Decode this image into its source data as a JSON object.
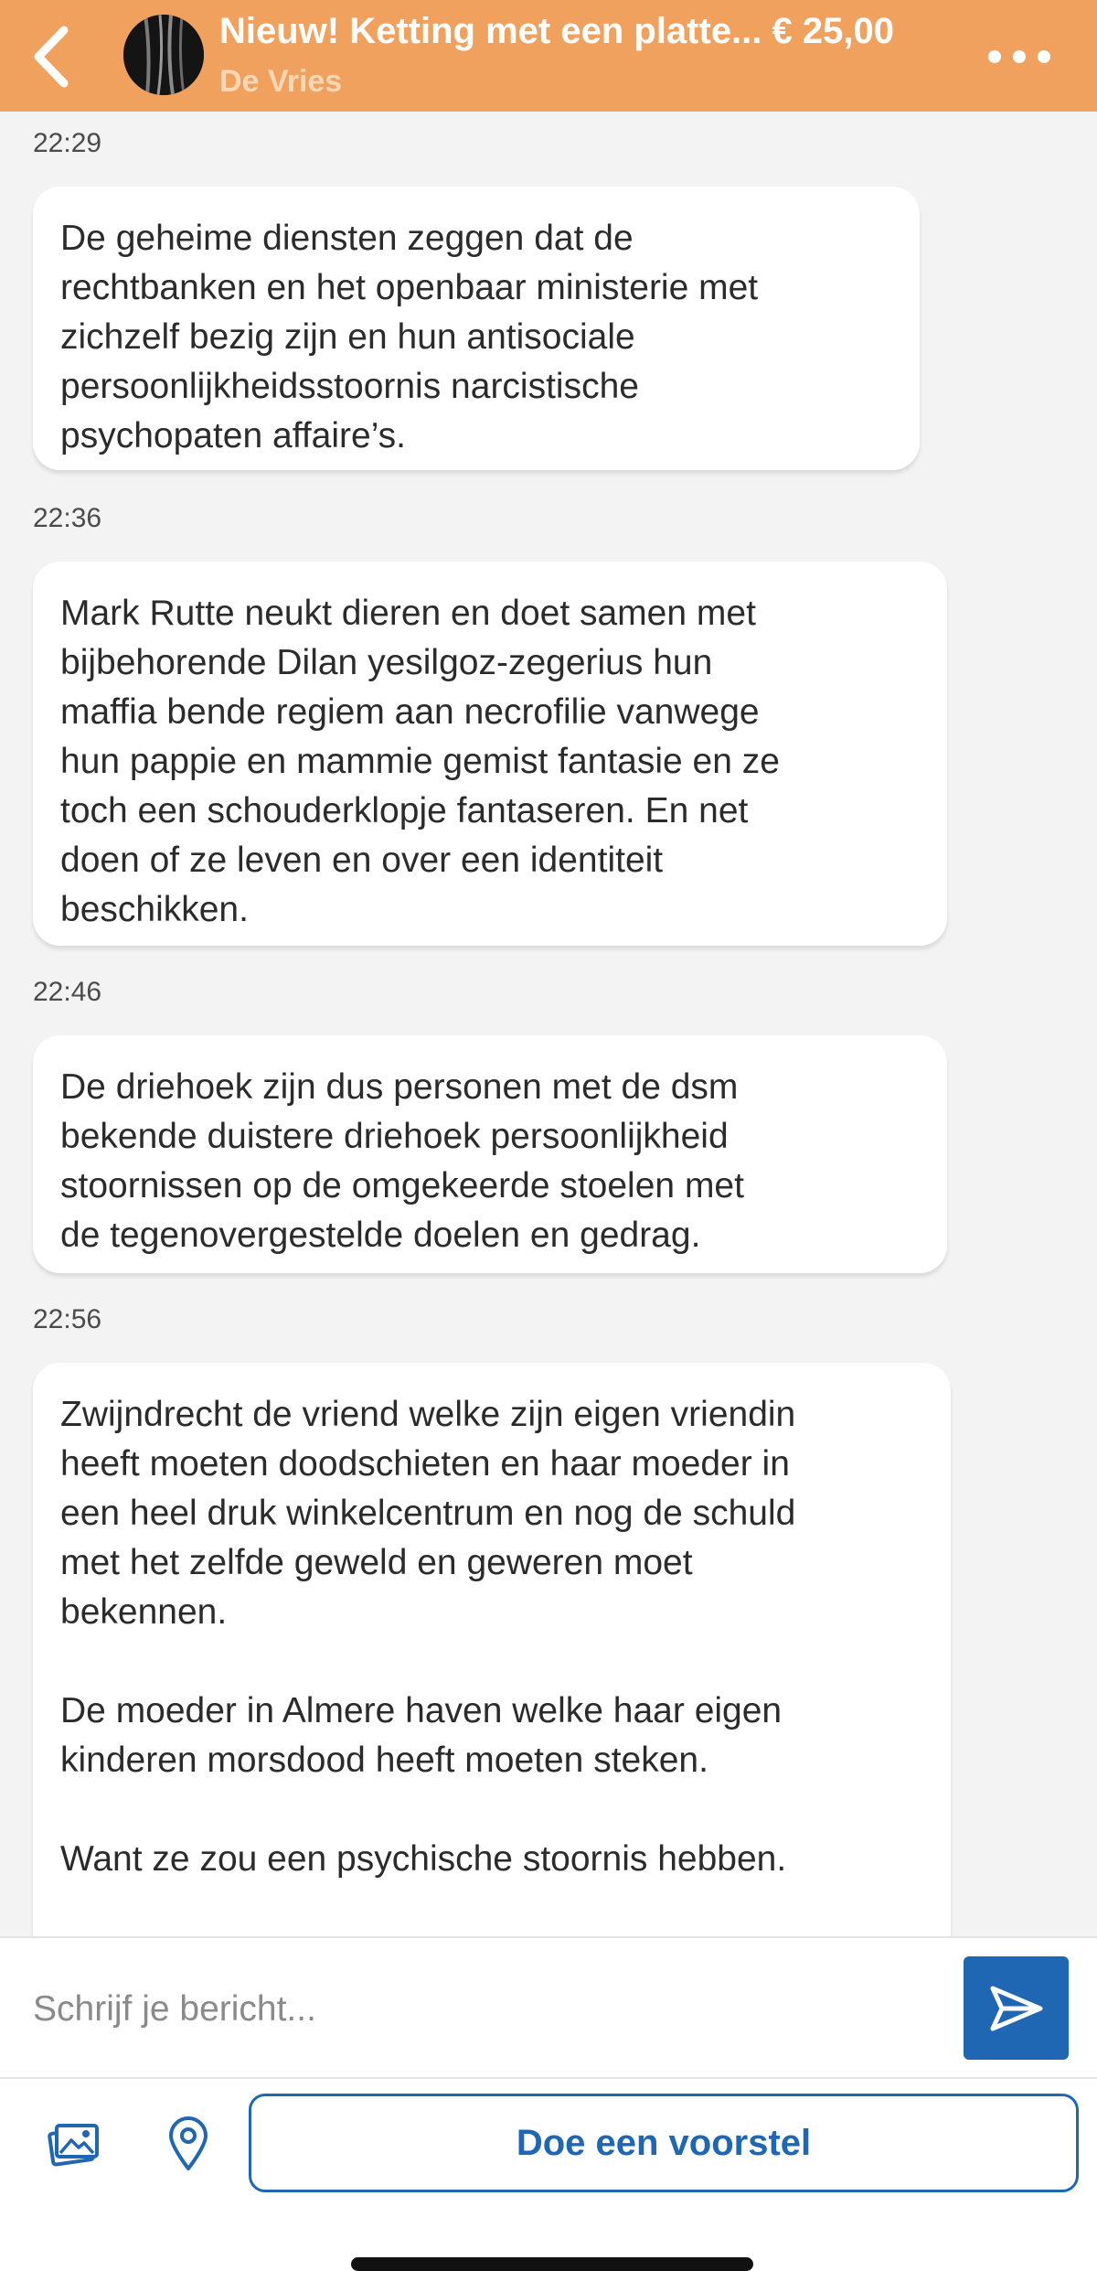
{
  "header": {
    "title": "Nieuw! Ketting met een platte... € 25,00",
    "seller": "De Vries",
    "back_icon": "chevron-left-icon",
    "menu_icon": "more-dots-icon",
    "colors": {
      "header_bg": "#f0a15e",
      "accent": "#1f66b3"
    }
  },
  "messages": [
    {
      "time": "22:29",
      "lines": [
        "De geheime diensten zeggen dat de",
        "rechtbanken en het openbaar ministerie met",
        "zichzelf bezig zijn en hun antisociale",
        "persoonlijkheidsstoornis narcistische",
        "psychopaten affaire’s."
      ]
    },
    {
      "time": "22:36",
      "lines": [
        "Mark Rutte neukt dieren en doet samen met",
        "bijbehorende Dilan yesilgoz-zegerius hun",
        "maffia bende regiem aan necrofilie vanwege",
        "hun pappie en mammie gemist fantasie en ze",
        "toch een schouderklopje fantaseren. En net",
        "doen of ze leven en over een identiteit",
        "beschikken."
      ]
    },
    {
      "time": "22:46",
      "lines": [
        "De driehoek zijn dus personen met de dsm",
        "bekende duistere driehoek persoonlijkheid",
        "stoornissen op de omgekeerde stoelen met",
        "de tegenovergestelde doelen en gedrag."
      ]
    },
    {
      "time": "22:56",
      "lines": [
        "Zwijndrecht de vriend welke zijn eigen vriendin",
        "heeft moeten doodschieten en haar moeder in",
        "een heel druk winkelcentrum en nog de schuld",
        "met het zelfde geweld en geweren moet",
        "bekennen.",
        "",
        "De moeder in Almere haven welke haar eigen",
        "kinderen morsdood heeft moeten steken.",
        "",
        "Want ze zou een psychische stoornis hebben."
      ]
    }
  ],
  "composer": {
    "placeholder": "Schrijf je bericht...",
    "send_icon": "send-icon"
  },
  "toolbar": {
    "photo_icon": "image-icon",
    "location_icon": "location-pin-icon",
    "offer_label": "Doe een voorstel"
  }
}
